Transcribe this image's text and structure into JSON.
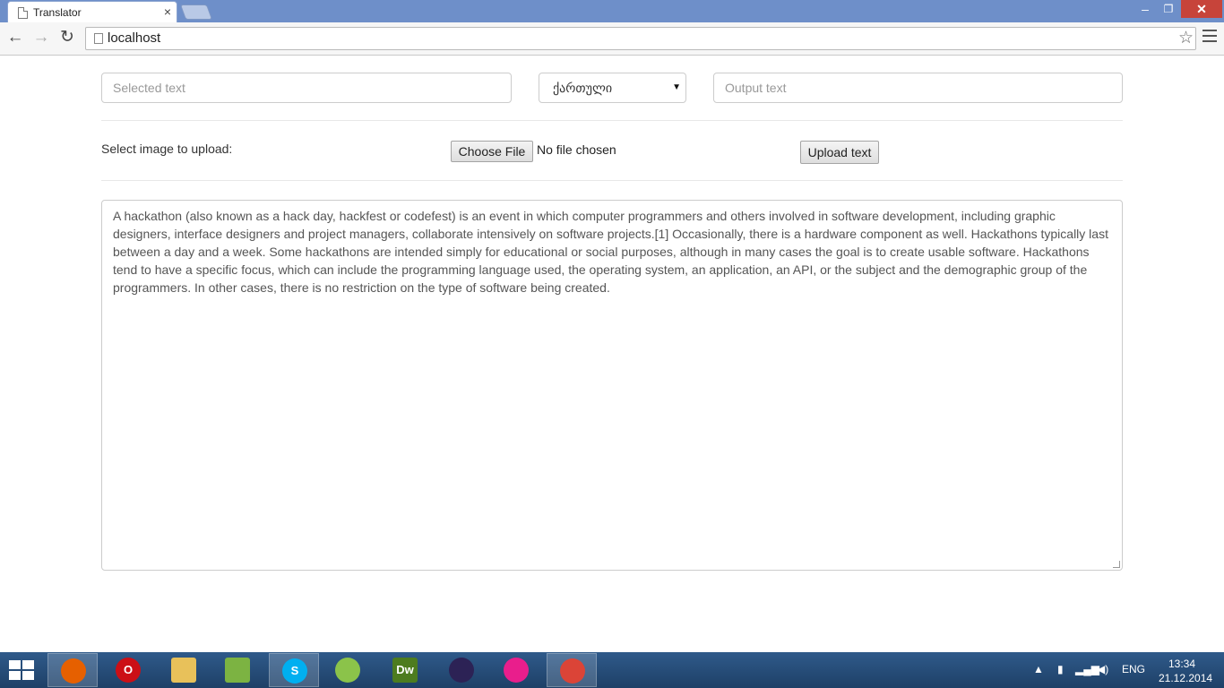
{
  "browser": {
    "tab_title": "Translator",
    "tab_close": "×",
    "url": "localhost",
    "window_controls": {
      "minimize": "–",
      "maximize": "❐",
      "close": "✕"
    },
    "nav": {
      "back": "←",
      "forward": "→",
      "reload": "↻",
      "bookmark": "☆"
    }
  },
  "form": {
    "selected_placeholder": "Selected text",
    "language_value": "ქართული",
    "output_placeholder": "Output text",
    "upload_label": "Select image to upload:",
    "choose_file_label": "Choose File",
    "file_status": "No file chosen",
    "upload_button": "Upload text",
    "body_text": "A hackathon (also known as a hack day, hackfest or codefest) is an event in which computer programmers and others involved in software development, including graphic designers, interface designers and project managers, collaborate intensively on software projects.[1] Occasionally, there is a hardware component as well. Hackathons typically last between a day and a week. Some hackathons are intended simply for educational or social purposes, although in many cases the goal is to create usable software. Hackathons tend to have a specific focus, which can include the programming language used, the operating system, an application, an API, or the subject and the demographic group of the programmers. In other cases, there is no restriction on the type of software being created."
  },
  "taskbar": {
    "apps": [
      {
        "name": "firefox-icon",
        "color": "#e66000",
        "label": ""
      },
      {
        "name": "opera-icon",
        "color": "#cc0f16",
        "label": "O"
      },
      {
        "name": "file-explorer-icon",
        "color": "#e8c15a",
        "label": ""
      },
      {
        "name": "notepad-plus-plus-icon",
        "color": "#7cb342",
        "label": ""
      },
      {
        "name": "skype-icon",
        "color": "#00aff0",
        "label": "S"
      },
      {
        "name": "codeblocks-icon",
        "color": "#8bc34a",
        "label": ""
      },
      {
        "name": "dreamweaver-icon",
        "color": "#4d7c1f",
        "label": "Dw"
      },
      {
        "name": "eclipse-icon",
        "color": "#2c2255",
        "label": ""
      },
      {
        "name": "wamp-icon",
        "color": "#e91e8c",
        "label": ""
      },
      {
        "name": "chrome-icon",
        "color": "#db4437",
        "label": ""
      }
    ],
    "tray": {
      "language": "ENG",
      "time": "13:34",
      "date": "21.12.2014"
    }
  }
}
